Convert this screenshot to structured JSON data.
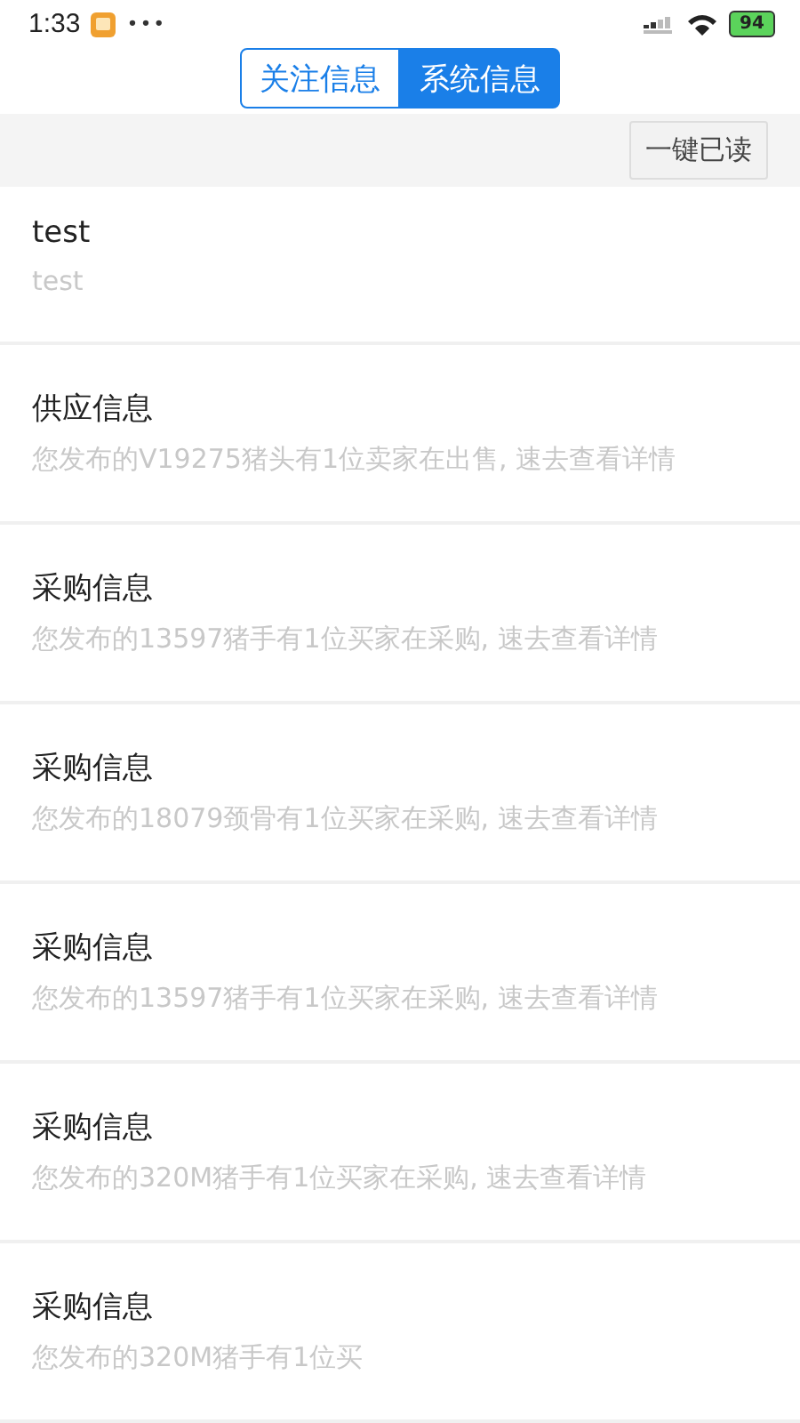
{
  "status_bar": {
    "time": "1:33",
    "dots": "•••",
    "battery": "94"
  },
  "tabs": [
    {
      "label": "关注信息",
      "selected": false
    },
    {
      "label": "系统信息",
      "selected": true
    }
  ],
  "toolbar": {
    "button": "一键已读"
  },
  "messages": [
    {
      "title": "test",
      "body": "test"
    },
    {
      "title": "供应信息",
      "body": "您发布的V19275猪头有1位卖家在出售, 速去查看详情"
    },
    {
      "title": "采购信息",
      "body": "您发布的13597猪手有1位买家在采购, 速去查看详情"
    },
    {
      "title": "采购信息",
      "body": "您发布的18079颈骨有1位买家在采购, 速去查看详情"
    },
    {
      "title": "采购信息",
      "body": "您发布的13597猪手有1位买家在采购, 速去查看详情"
    },
    {
      "title": "采购信息",
      "body": "您发布的320M猪手有1位买家在采购, 速去查看详情"
    },
    {
      "title": "采购信息",
      "body": "您发布的320M猪手有1位买"
    }
  ]
}
